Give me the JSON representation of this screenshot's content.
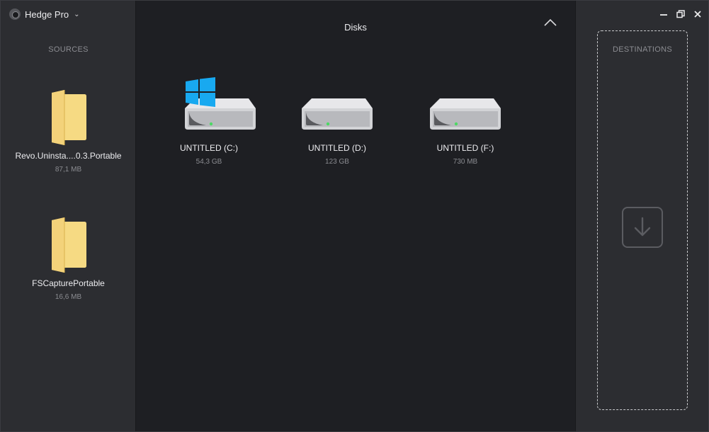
{
  "app": {
    "name": "Hedge Pro",
    "chevron_icon": "chevron-down-icon"
  },
  "sources": {
    "heading": "SOURCES",
    "items": [
      {
        "name": "Revo.Uninsta....0.3.Portable",
        "size": "87,1 MB",
        "icon": "folder-icon"
      },
      {
        "name": "FSCapturePortable",
        "size": "16,6 MB",
        "icon": "folder-icon"
      }
    ]
  },
  "disks": {
    "title": "Disks",
    "items": [
      {
        "name": "UNTITLED (C:)",
        "size": "54,3 GB",
        "icon": "hard-drive-icon",
        "system": true
      },
      {
        "name": "UNTITLED (D:)",
        "size": "123 GB",
        "icon": "hard-drive-icon",
        "system": false
      },
      {
        "name": "UNTITLED (F:)",
        "size": "730 MB",
        "icon": "hard-drive-icon",
        "system": false
      }
    ]
  },
  "destinations": {
    "heading": "DESTINATIONS",
    "drop_icon": "download-arrow-icon"
  },
  "colors": {
    "panel": "#2c2d31",
    "center": "#1e1f23",
    "folder": "#f4d57a",
    "windows_logo": "#18a9f0",
    "drive_led": "#4cd964"
  }
}
